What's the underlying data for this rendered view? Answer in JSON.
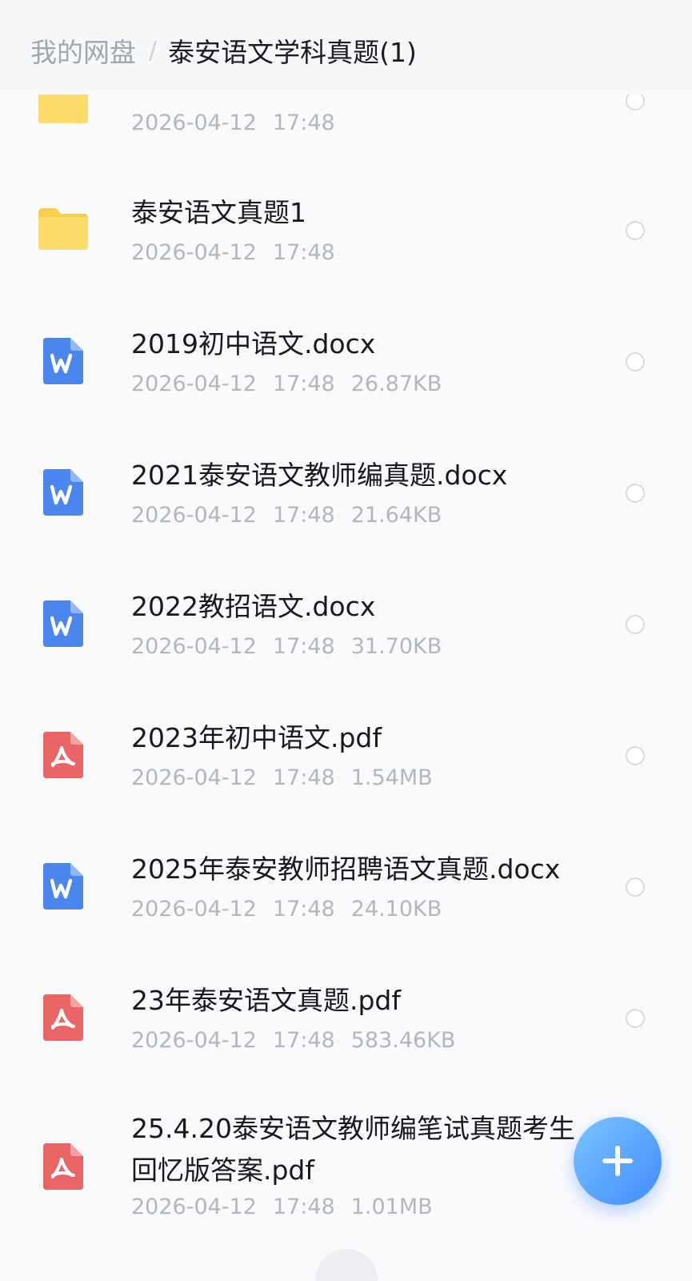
{
  "breadcrumb": {
    "root": "我的网盘",
    "separator": "/",
    "current": "泰安语文学科真题(1)"
  },
  "files": [
    {
      "type": "folder",
      "icon": "folder-icon",
      "name": "",
      "date": "2026-04-12",
      "time": "17:48",
      "size": ""
    },
    {
      "type": "folder",
      "icon": "folder-icon",
      "name": "泰安语文真题1",
      "date": "2026-04-12",
      "time": "17:48",
      "size": ""
    },
    {
      "type": "docx",
      "icon": "word-doc-icon",
      "name": "2019初中语文.docx",
      "date": "2026-04-12",
      "time": "17:48",
      "size": "26.87KB"
    },
    {
      "type": "docx",
      "icon": "word-doc-icon",
      "name": "2021泰安语文教师编真题.docx",
      "date": "2026-04-12",
      "time": "17:48",
      "size": "21.64KB"
    },
    {
      "type": "docx",
      "icon": "word-doc-icon",
      "name": "2022教招语文.docx",
      "date": "2026-04-12",
      "time": "17:48",
      "size": "31.70KB"
    },
    {
      "type": "pdf",
      "icon": "pdf-doc-icon",
      "name": "2023年初中语文.pdf",
      "date": "2026-04-12",
      "time": "17:48",
      "size": "1.54MB"
    },
    {
      "type": "docx",
      "icon": "word-doc-icon",
      "name": "2025年泰安教师招聘语文真题.docx",
      "date": "2026-04-12",
      "time": "17:48",
      "size": "24.10KB"
    },
    {
      "type": "pdf",
      "icon": "pdf-doc-icon",
      "name": "23年泰安语文真题.pdf",
      "date": "2026-04-12",
      "time": "17:48",
      "size": "583.46KB"
    },
    {
      "type": "pdf",
      "icon": "pdf-doc-icon",
      "name": "25.4.20泰安语文教师编笔试真题考生回忆版答案.pdf",
      "date": "2026-04-12",
      "time": "17:48",
      "size": "1.01MB"
    }
  ],
  "fab": {
    "icon": "plus-icon"
  },
  "colors": {
    "folder": "#f9d65c",
    "word": "#4b86ee",
    "pdf": "#ea6565",
    "fab": "#3f8cff"
  }
}
